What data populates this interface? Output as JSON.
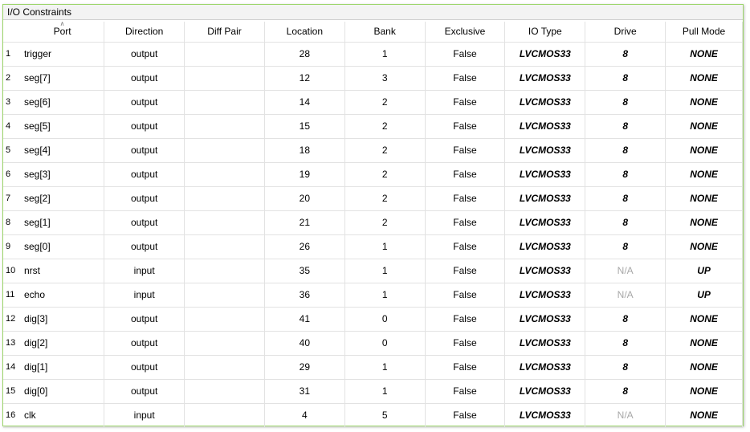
{
  "window": {
    "title": "I/O Constraints"
  },
  "columns": [
    {
      "key": "port",
      "label": "Port"
    },
    {
      "key": "direction",
      "label": "Direction"
    },
    {
      "key": "diff_pair",
      "label": "Diff Pair"
    },
    {
      "key": "location",
      "label": "Location"
    },
    {
      "key": "bank",
      "label": "Bank"
    },
    {
      "key": "exclusive",
      "label": "Exclusive"
    },
    {
      "key": "io_type",
      "label": "IO Type"
    },
    {
      "key": "drive",
      "label": "Drive"
    },
    {
      "key": "pull_mode",
      "label": "Pull Mode"
    }
  ],
  "sort_icon": "sort-ascending-icon",
  "rows": [
    {
      "num": "1",
      "port": "trigger",
      "direction": "output",
      "diff_pair": "",
      "location": "28",
      "bank": "1",
      "exclusive": "False",
      "io_type": "LVCMOS33",
      "drive": "8",
      "pull_mode": "NONE"
    },
    {
      "num": "2",
      "port": "seg[7]",
      "direction": "output",
      "diff_pair": "",
      "location": "12",
      "bank": "3",
      "exclusive": "False",
      "io_type": "LVCMOS33",
      "drive": "8",
      "pull_mode": "NONE"
    },
    {
      "num": "3",
      "port": "seg[6]",
      "direction": "output",
      "diff_pair": "",
      "location": "14",
      "bank": "2",
      "exclusive": "False",
      "io_type": "LVCMOS33",
      "drive": "8",
      "pull_mode": "NONE"
    },
    {
      "num": "4",
      "port": "seg[5]",
      "direction": "output",
      "diff_pair": "",
      "location": "15",
      "bank": "2",
      "exclusive": "False",
      "io_type": "LVCMOS33",
      "drive": "8",
      "pull_mode": "NONE"
    },
    {
      "num": "5",
      "port": "seg[4]",
      "direction": "output",
      "diff_pair": "",
      "location": "18",
      "bank": "2",
      "exclusive": "False",
      "io_type": "LVCMOS33",
      "drive": "8",
      "pull_mode": "NONE"
    },
    {
      "num": "6",
      "port": "seg[3]",
      "direction": "output",
      "diff_pair": "",
      "location": "19",
      "bank": "2",
      "exclusive": "False",
      "io_type": "LVCMOS33",
      "drive": "8",
      "pull_mode": "NONE"
    },
    {
      "num": "7",
      "port": "seg[2]",
      "direction": "output",
      "diff_pair": "",
      "location": "20",
      "bank": "2",
      "exclusive": "False",
      "io_type": "LVCMOS33",
      "drive": "8",
      "pull_mode": "NONE"
    },
    {
      "num": "8",
      "port": "seg[1]",
      "direction": "output",
      "diff_pair": "",
      "location": "21",
      "bank": "2",
      "exclusive": "False",
      "io_type": "LVCMOS33",
      "drive": "8",
      "pull_mode": "NONE"
    },
    {
      "num": "9",
      "port": "seg[0]",
      "direction": "output",
      "diff_pair": "",
      "location": "26",
      "bank": "1",
      "exclusive": "False",
      "io_type": "LVCMOS33",
      "drive": "8",
      "pull_mode": "NONE"
    },
    {
      "num": "10",
      "port": "nrst",
      "direction": "input",
      "diff_pair": "",
      "location": "35",
      "bank": "1",
      "exclusive": "False",
      "io_type": "LVCMOS33",
      "drive": "N/A",
      "pull_mode": "UP"
    },
    {
      "num": "11",
      "port": "echo",
      "direction": "input",
      "diff_pair": "",
      "location": "36",
      "bank": "1",
      "exclusive": "False",
      "io_type": "LVCMOS33",
      "drive": "N/A",
      "pull_mode": "UP"
    },
    {
      "num": "12",
      "port": "dig[3]",
      "direction": "output",
      "diff_pair": "",
      "location": "41",
      "bank": "0",
      "exclusive": "False",
      "io_type": "LVCMOS33",
      "drive": "8",
      "pull_mode": "NONE"
    },
    {
      "num": "13",
      "port": "dig[2]",
      "direction": "output",
      "diff_pair": "",
      "location": "40",
      "bank": "0",
      "exclusive": "False",
      "io_type": "LVCMOS33",
      "drive": "8",
      "pull_mode": "NONE"
    },
    {
      "num": "14",
      "port": "dig[1]",
      "direction": "output",
      "diff_pair": "",
      "location": "29",
      "bank": "1",
      "exclusive": "False",
      "io_type": "LVCMOS33",
      "drive": "8",
      "pull_mode": "NONE"
    },
    {
      "num": "15",
      "port": "dig[0]",
      "direction": "output",
      "diff_pair": "",
      "location": "31",
      "bank": "1",
      "exclusive": "False",
      "io_type": "LVCMOS33",
      "drive": "8",
      "pull_mode": "NONE"
    },
    {
      "num": "16",
      "port": "clk",
      "direction": "input",
      "diff_pair": "",
      "location": "4",
      "bank": "5",
      "exclusive": "False",
      "io_type": "LVCMOS33",
      "drive": "N/A",
      "pull_mode": "NONE"
    }
  ]
}
